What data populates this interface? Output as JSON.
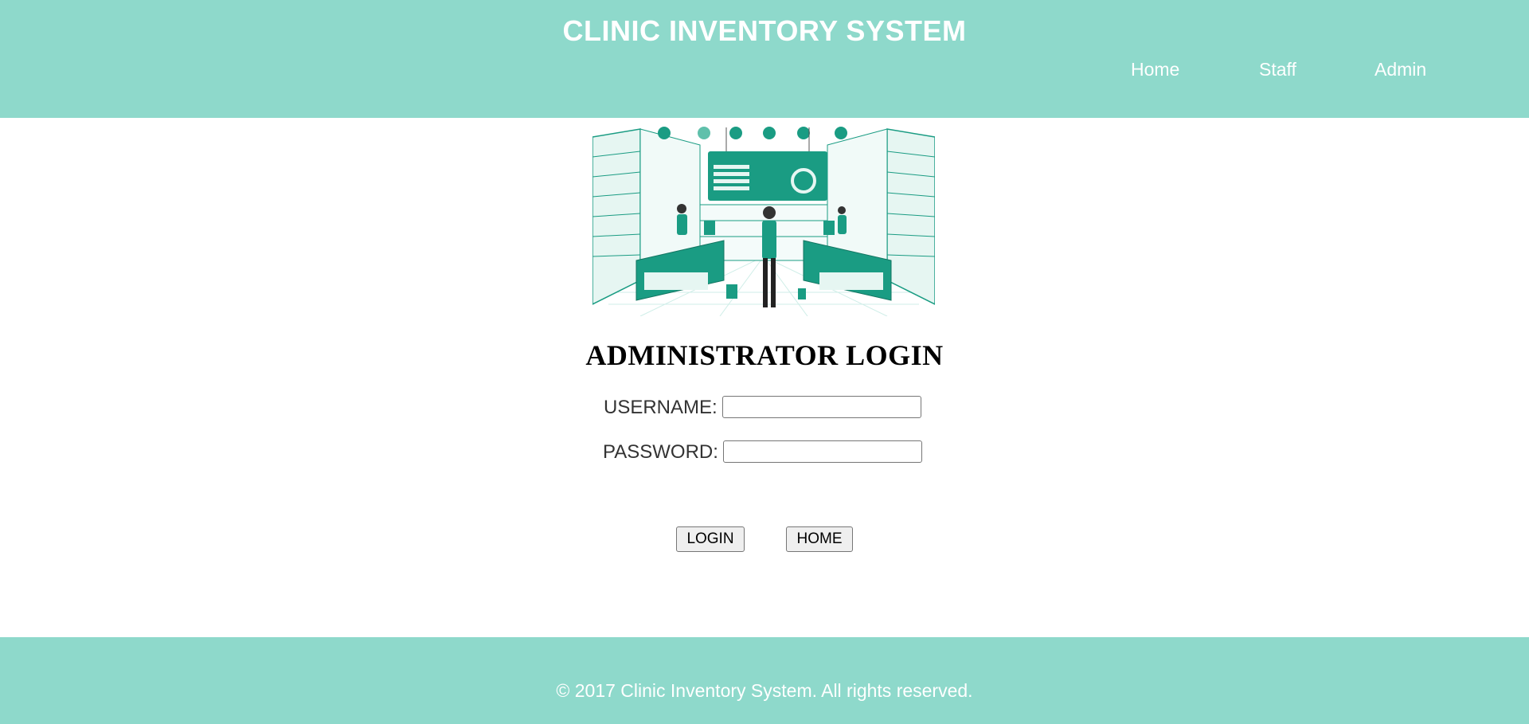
{
  "header": {
    "title": "CLINIC INVENTORY SYSTEM",
    "nav": [
      {
        "label": "Home"
      },
      {
        "label": "Staff"
      },
      {
        "label": "Admin"
      }
    ]
  },
  "hero": {
    "icon": "pharmacy-illustration"
  },
  "login": {
    "heading": "ADMINISTRATOR LOGIN",
    "username_label": "USERNAME:",
    "username_value": "",
    "password_label": "PASSWORD:",
    "password_value": "",
    "login_button": "LOGIN",
    "home_button": "HOME"
  },
  "footer": {
    "text": "© 2017 Clinic Inventory System. All rights reserved."
  },
  "colors": {
    "accent": "#8ed9cb",
    "illustration": "#1a9c83"
  }
}
